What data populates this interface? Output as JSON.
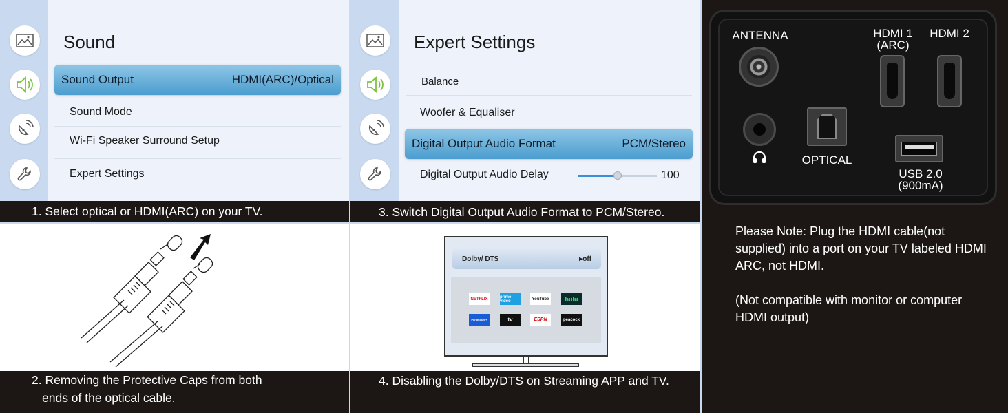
{
  "panel1": {
    "title": "Sound",
    "highlight": {
      "label": "Sound Output",
      "value": "HDMI(ARC)/Optical"
    },
    "items": [
      "Sound Mode",
      "Wi-Fi Speaker Surround Setup",
      "Expert Settings"
    ],
    "caption": "1. Select optical or HDMI(ARC) on your TV."
  },
  "panel3": {
    "title": "Expert Settings",
    "items": [
      "Balance",
      "Woofer & Equaliser"
    ],
    "highlight": {
      "label": "Digital Output Audio Format",
      "value": "PCM/Stereo"
    },
    "delay": {
      "label": "Digital Output Audio Delay",
      "value": "100",
      "level": 0.5
    },
    "caption": "3. Switch Digital Output Audio Format to PCM/Stereo."
  },
  "panel2": {
    "caption_line1": "2. Removing the Protective Caps from  both",
    "caption_line2": "ends of the optical cable."
  },
  "panel4": {
    "dolby_label": "Dolby/ DTS",
    "dolby_value": "▸off",
    "apps": [
      "NETFLIX",
      "prime video",
      "YouTube",
      "hulu",
      "Paramount+",
      "tv",
      "ESPN",
      "peacock"
    ],
    "caption": "4. Disabling the Dolby/DTS on Streaming APP and TV."
  },
  "ports": {
    "antenna": "ANTENNA",
    "hdmi1_line1": "HDMI 1",
    "hdmi1_line2": "(ARC)",
    "hdmi2": "HDMI 2",
    "optical": "OPTICAL",
    "usb_line1": "USB 2.0",
    "usb_line2": "(900mA)"
  },
  "note": {
    "para1": "Please Note: Plug the HDMI cable(not supplied) into a port on your TV labeled HDMI ARC, not HDMI.",
    "para2": "(Not compatible with monitor or computer HDMI output)"
  },
  "icons": [
    "picture-icon",
    "speaker-icon",
    "satellite-icon",
    "wrench-icon"
  ],
  "colors": {
    "highlight_top": "#8fc6e6",
    "highlight_bottom": "#4b9dcf",
    "speaker_green": "#7cc242",
    "slider_blue": "#3a8fd8"
  }
}
